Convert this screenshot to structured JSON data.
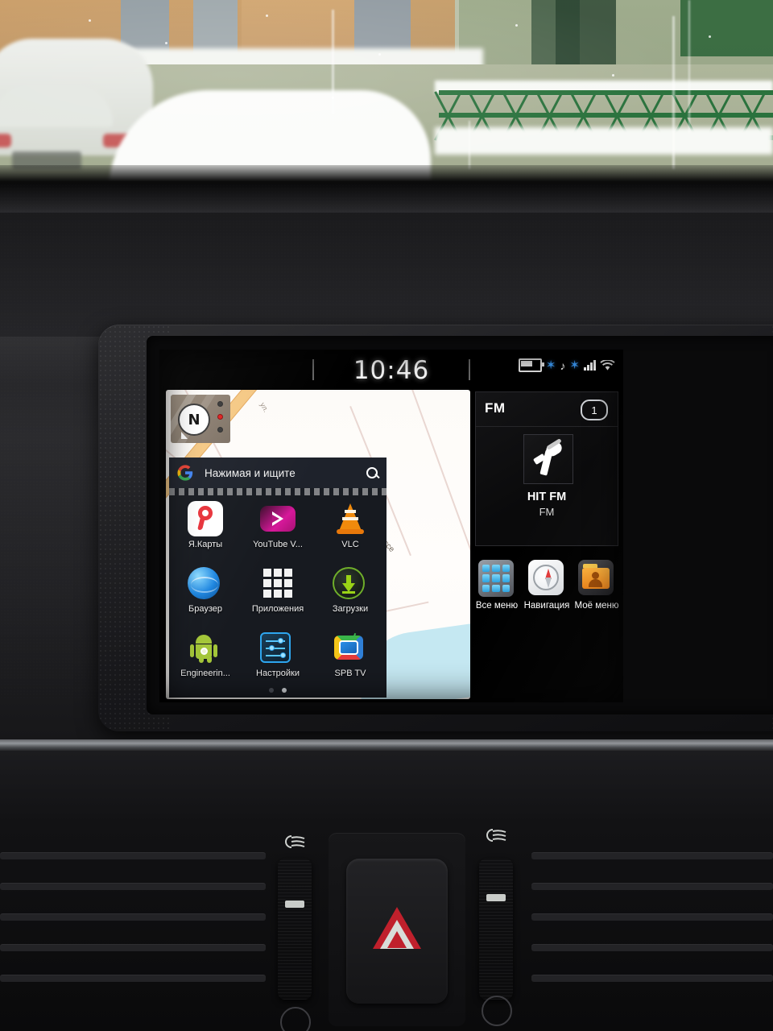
{
  "photo": {
    "scene": "snowy-street-through-windshield",
    "vehicle_interior": "car-dashboard"
  },
  "head_unit": {
    "status_bar": {
      "time": "10:46",
      "icons": [
        {
          "name": "battery-icon",
          "label": "battery"
        },
        {
          "name": "bluetooth-audio-icon",
          "label": "bluetooth-audio"
        },
        {
          "name": "bluetooth-phone-signal-icon",
          "label": "bluetooth-phone-signal"
        },
        {
          "name": "wifi-icon",
          "label": "wifi"
        }
      ]
    },
    "home_panel": {
      "map_widget": {
        "compass_label": "N",
        "road_label": "ское шоссе",
        "minor_label": "ул."
      },
      "search": {
        "placeholder": "Нажимая и ищите",
        "logo": "google-g-logo",
        "icon": "search-icon"
      },
      "apps": [
        {
          "label": "Я.Карты",
          "icon": "yandex-maps-icon"
        },
        {
          "label": "YouTube V...",
          "icon": "youtube-vanced-icon"
        },
        {
          "label": "VLC",
          "icon": "vlc-cone-icon"
        },
        {
          "label": "Браузер",
          "icon": "browser-globe-icon"
        },
        {
          "label": "Приложения",
          "icon": "apps-grid-icon"
        },
        {
          "label": "Загрузки",
          "icon": "downloads-icon"
        },
        {
          "label": "Engineerin...",
          "icon": "android-robot-icon"
        },
        {
          "label": "Настройки",
          "icon": "settings-sliders-icon"
        },
        {
          "label": "SPB TV",
          "icon": "spb-tv-icon"
        }
      ],
      "pages": {
        "count": 2,
        "active": 2
      }
    },
    "radio_card": {
      "band": "FM",
      "preset": "1",
      "station_name": "HIT FM",
      "station_band": "FM",
      "artwork_icon": "microphone-icon"
    },
    "shortcuts": [
      {
        "label": "Все меню",
        "icon": "all-menu-grid-icon"
      },
      {
        "label": "Навигация",
        "icon": "navigation-compass-icon"
      },
      {
        "label": "Моё меню",
        "icon": "my-menu-folder-icon"
      }
    ]
  },
  "dashboard": {
    "hazard_button": "hazard-warning-triangle",
    "vent_controls": [
      "air-flow-wheel-left",
      "air-flow-wheel-right"
    ]
  },
  "colors": {
    "accent_blue": "#2ba2e0",
    "bluetooth_blue": "#3ea0ff",
    "hazard_red": "#c0202c",
    "screen_bg": "#000000",
    "panel_bg": "#171a20"
  }
}
